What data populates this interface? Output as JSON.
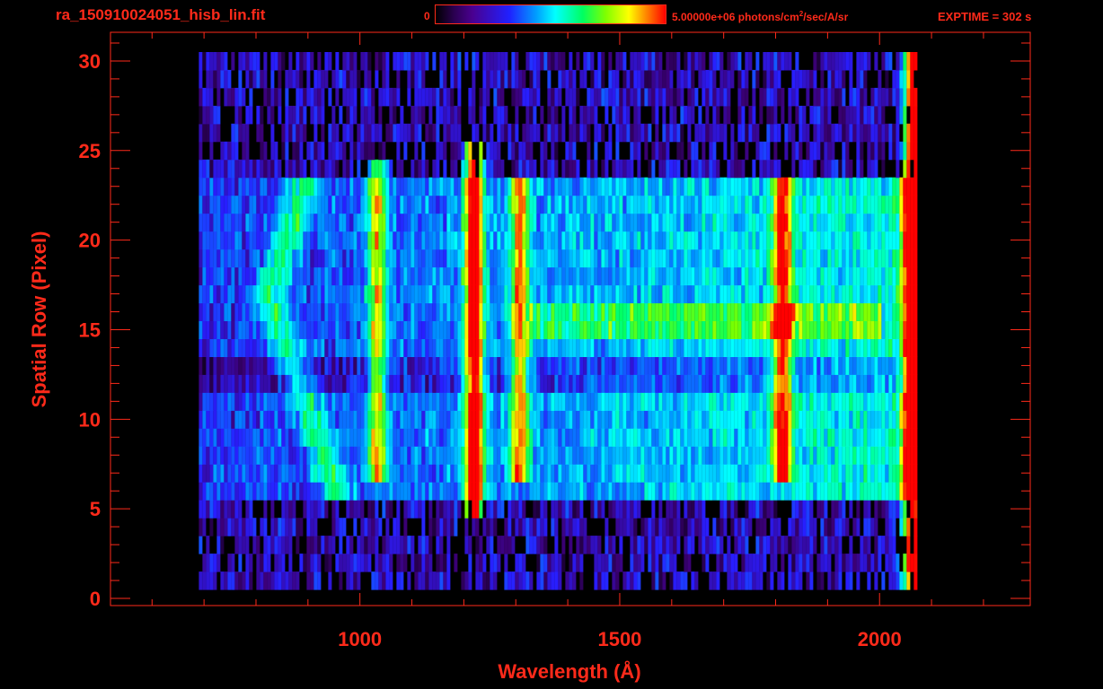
{
  "header": {
    "file_title": "ra_150910024051_hisb_lin.fit",
    "colorbar_min": "0",
    "colorbar_max": "5.00000e+06 photons/cm",
    "colorbar_max_exp": "2",
    "colorbar_max_tail": "/sec/A/sr",
    "exptime": "EXPTIME = 302 s"
  },
  "colors": {
    "axis": "#ff2a1a",
    "background": "#000000"
  },
  "chart_data": {
    "type": "heatmap",
    "title": "ra_150910024051_hisb_lin.fit",
    "xlabel": "Wavelength (Å)",
    "ylabel": "Spatial Row (Pixel)",
    "xlim": [
      520,
      2290
    ],
    "ylim": [
      -0.4,
      31.6
    ],
    "x_ticks": [
      1000,
      1500,
      2000
    ],
    "x_tick_labels": [
      "1000",
      "1500",
      "2000"
    ],
    "y_ticks": [
      0,
      5,
      10,
      15,
      20,
      25,
      30
    ],
    "y_tick_labels": [
      "0",
      "5",
      "10",
      "15",
      "20",
      "25",
      "30"
    ],
    "colorbar_range": [
      0,
      5000000
    ],
    "colorbar_units": "photons/cm^2/sec/A/sr",
    "colormap": "rainbow",
    "signal_extent_x": [
      690,
      2070
    ],
    "slit_rows": [
      6,
      23
    ],
    "emission_lines": [
      {
        "wavelength": 1216,
        "rows": [
          5,
          25
        ],
        "level": 0.9
      },
      {
        "wavelength": 1304,
        "rows": [
          7,
          23
        ],
        "level": 0.58
      },
      {
        "wavelength": 1030,
        "rows": [
          7,
          24
        ],
        "level": 0.55
      },
      {
        "wavelength": 1810,
        "rows": [
          7,
          23
        ],
        "level": 0.62
      },
      {
        "wavelength": 2060,
        "rows": [
          1,
          30
        ],
        "level": 0.95
      }
    ]
  }
}
